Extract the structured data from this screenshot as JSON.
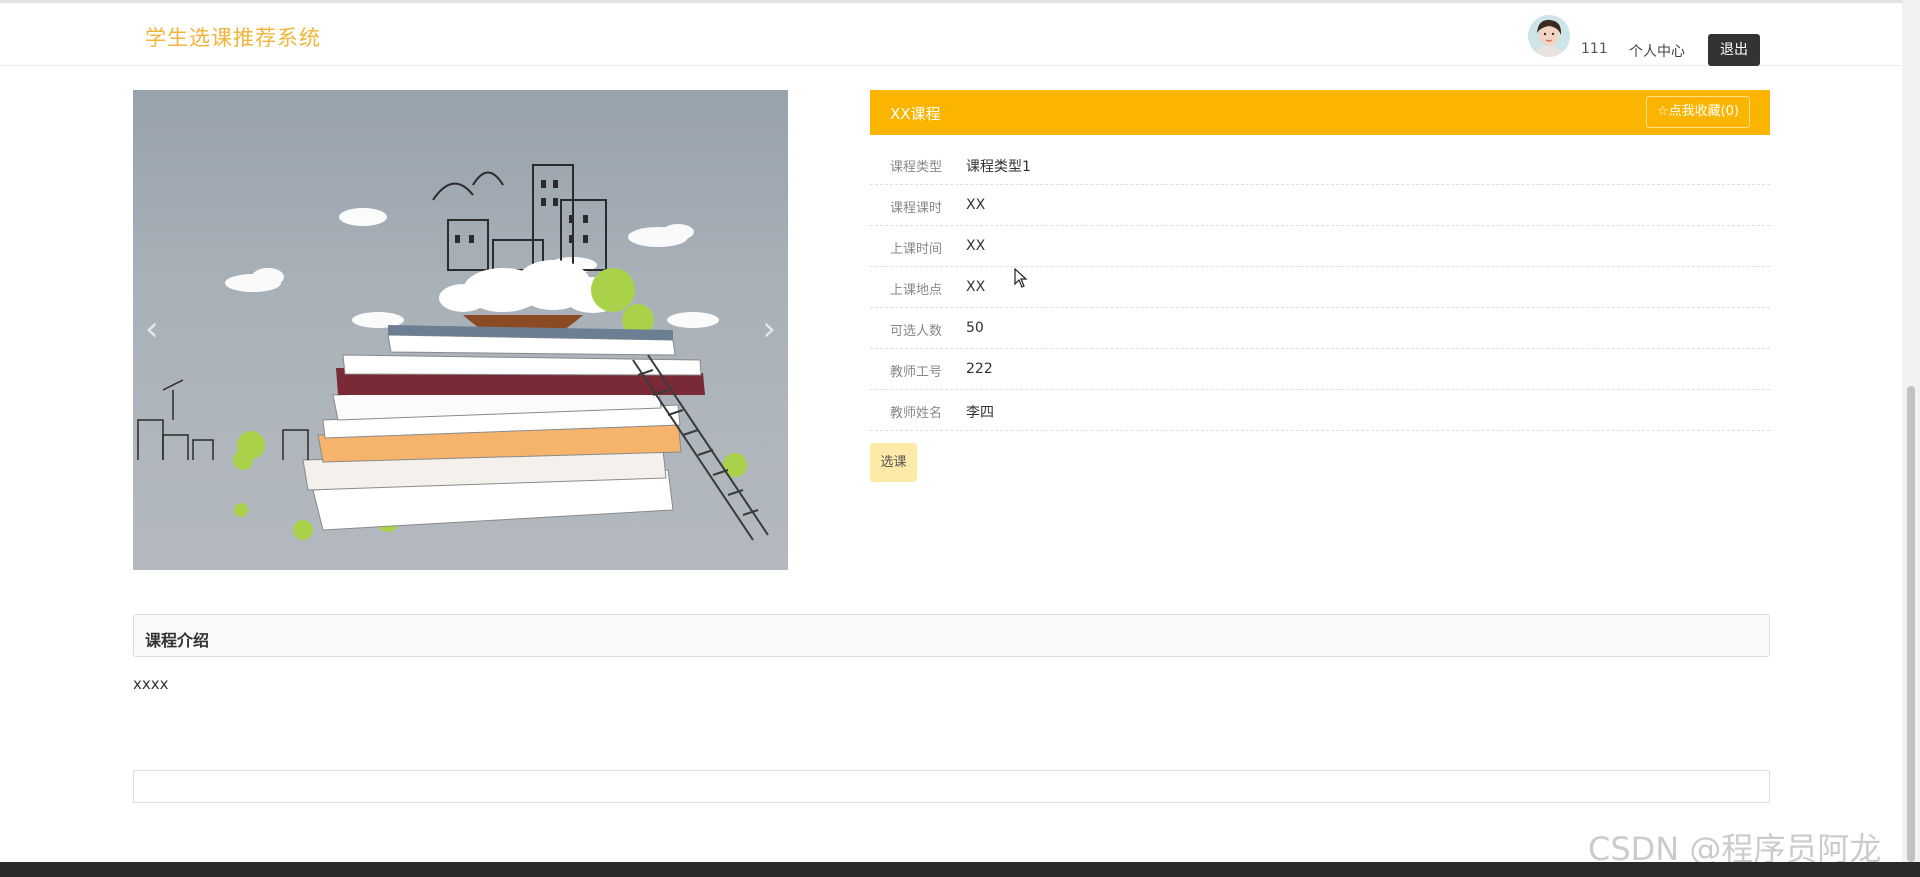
{
  "header": {
    "brand": "学生选课推荐系统",
    "username": "111",
    "user_center": "个人中心",
    "logout": "退出"
  },
  "carousel": {
    "prev_icon": "‹",
    "next_icon": "›"
  },
  "course": {
    "title": "XX课程",
    "favorite_label": "☆点我收藏(0)",
    "fields": [
      {
        "label": "课程类型",
        "value": "课程类型1"
      },
      {
        "label": "课程课时",
        "value": "XX"
      },
      {
        "label": "上课时间",
        "value": "XX"
      },
      {
        "label": "上课地点",
        "value": "XX"
      },
      {
        "label": "可选人数",
        "value": "50"
      },
      {
        "label": "教师工号",
        "value": "222"
      },
      {
        "label": "教师姓名",
        "value": "李四"
      }
    ],
    "select_button": "选课"
  },
  "intro": {
    "title": "课程介绍",
    "content": "xxxx"
  },
  "watermark": "CSDN @程序员阿龙",
  "colors": {
    "brand": "#f0b43a",
    "accent": "#fbb500",
    "select_button_bg": "#fde9a8",
    "logout_bg": "#333333"
  }
}
